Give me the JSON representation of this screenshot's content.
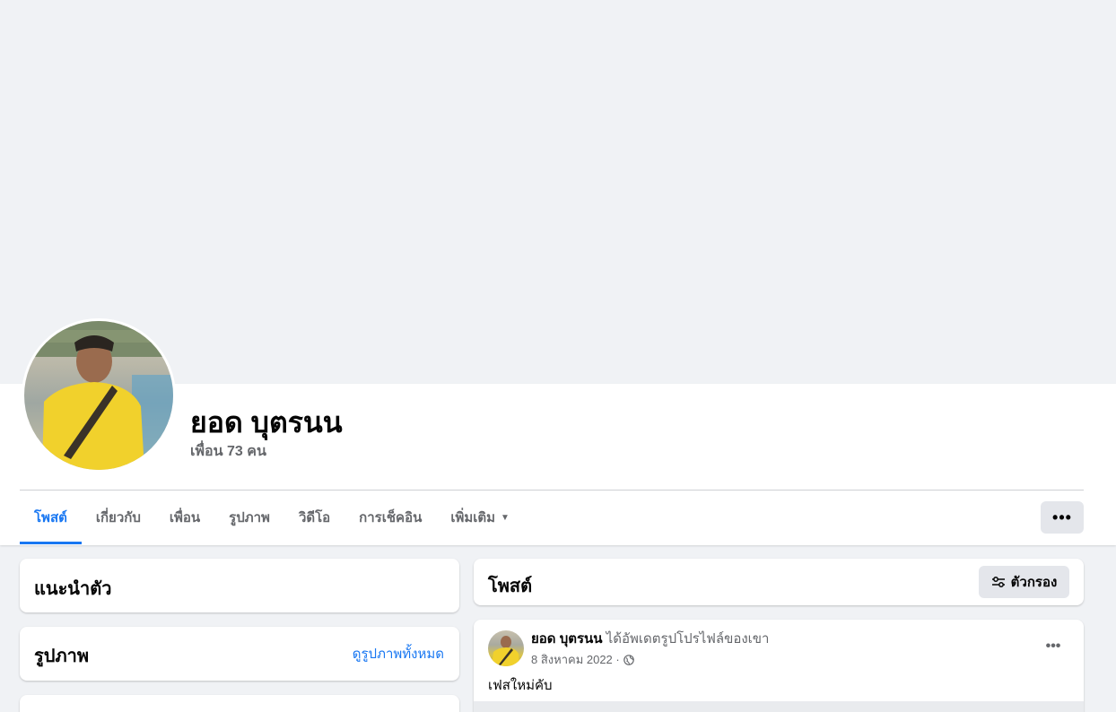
{
  "profile": {
    "name": "ยอด บุตรนน",
    "friends": "เพื่อน 73 คน"
  },
  "tabs": [
    {
      "label": "โพสต์",
      "active": true
    },
    {
      "label": "เกี่ยวกับ"
    },
    {
      "label": "เพื่อน"
    },
    {
      "label": "รูปภาพ"
    },
    {
      "label": "วิดีโอ"
    },
    {
      "label": "การเช็คอิน"
    },
    {
      "label": "เพิ่มเติม"
    }
  ],
  "more_button": "•••",
  "intro": {
    "title": "แนะนำตัว"
  },
  "photos": {
    "title": "รูปภาพ",
    "link": "ดูรูปภาพทั้งหมด"
  },
  "posts": {
    "title": "โพสต์",
    "filter": "ตัวกรอง"
  },
  "post": {
    "author": "ยอด บุตรนน",
    "action": "ได้อัพเดตรูปโปรไฟล์ของเขา",
    "date": "8 สิงหาคม 2022 ·",
    "text": "เฟสใหม่คับ",
    "menu": "•••"
  },
  "colors": {
    "accent": "#1877f2",
    "background": "#f0f2f5",
    "secondary_text": "#65676b"
  }
}
